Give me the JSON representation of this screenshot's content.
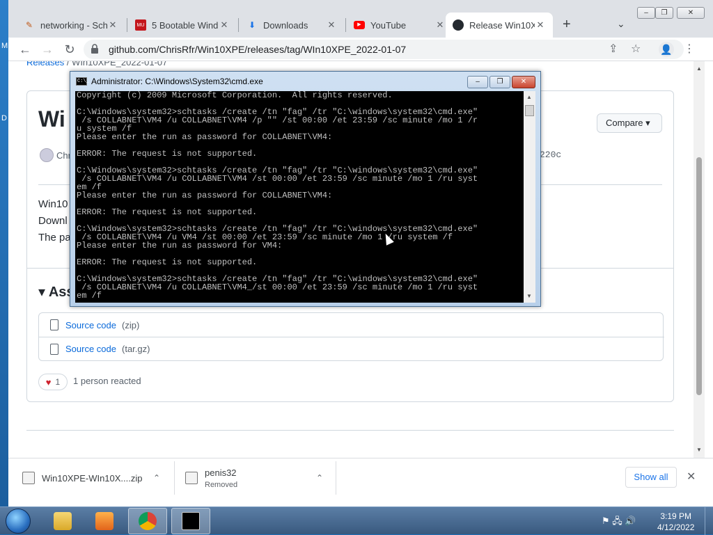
{
  "window_controls": {
    "minimize": "–",
    "maximize": "❐",
    "close": "✕"
  },
  "tabs": [
    {
      "label": "networking - Sch",
      "close": "✕"
    },
    {
      "label": "5 Bootable Wind",
      "close": "✕"
    },
    {
      "label": "Downloads",
      "close": "✕"
    },
    {
      "label": "YouTube",
      "close": "✕"
    },
    {
      "label": "Release Win10XP",
      "close": "✕"
    }
  ],
  "new_tab": "+",
  "tab_search": "⌄",
  "toolbar": {
    "back": "←",
    "forward": "→",
    "reload": "↻",
    "url": "github.com/ChrisRfr/Win10XPE/releases/tag/WIn10XPE_2022-01-07",
    "share": "⇪",
    "star": "☆",
    "menu": "⋮",
    "avatar": "👤"
  },
  "page": {
    "crumb_link": "Releases",
    "crumb_sep": " / ",
    "crumb_current": "WIn10XPE_2022-01-07",
    "release_title": "Wi",
    "author": "Chr",
    "commit": "220c",
    "compare_label": "Compare ▾",
    "body_lines": [
      "Win10",
      "Downl",
      "The pa"
    ],
    "assets_label": "▾ Ass",
    "assets": [
      {
        "name": "Source code",
        "type": "(zip)"
      },
      {
        "name": "Source code",
        "type": "(tar.gz)"
      }
    ],
    "reaction_heart": "♥",
    "reaction_count": "1",
    "reacted_text": "1 person reacted"
  },
  "cmd": {
    "title": "Administrator: C:\\Windows\\System32\\cmd.exe",
    "icon_text": "C:\\_",
    "minimize": "–",
    "maximize": "❐",
    "close": "✕",
    "lines": [
      "Copyright (c) 2009 Microsoft Corporation.  All rights reserved.",
      "",
      "C:\\Windows\\system32>schtasks /create /tn \"fag\" /tr \"C:\\windows\\system32\\cmd.exe\"",
      " /s COLLABNET\\VM4 /u COLLABNET\\VM4 /p \"\" /st 00:00 /et 23:59 /sc minute /mo 1 /r",
      "u system /f",
      "Please enter the run as password for COLLABNET\\VM4:",
      "",
      "ERROR: The request is not supported.",
      "",
      "C:\\Windows\\system32>schtasks /create /tn \"fag\" /tr \"C:\\windows\\system32\\cmd.exe\"",
      " /s COLLABNET\\VM4 /u COLLABNET\\VM4 /st 00:00 /et 23:59 /sc minute /mo 1 /ru syst",
      "em /f",
      "Please enter the run as password for COLLABNET\\VM4:",
      "",
      "ERROR: The request is not supported.",
      "",
      "C:\\Windows\\system32>schtasks /create /tn \"fag\" /tr \"C:\\windows\\system32\\cmd.exe\"",
      " /s COLLABNET\\VM4 /u VM4 /st 00:00 /et 23:59 /sc minute /mo 1 /ru system /f",
      "Please enter the run as password for VM4:",
      "",
      "ERROR: The request is not supported.",
      "",
      "C:\\Windows\\system32>schtasks /create /tn \"fag\" /tr \"C:\\windows\\system32\\cmd.exe\"",
      " /s COLLABNET\\VM4 /u COLLABNET\\VM4_/st 00:00 /et 23:59 /sc minute /mo 1 /ru syst",
      "em /f"
    ]
  },
  "downloads": [
    {
      "name": "Win10XPE-WIn10X....zip",
      "chevron": "⌃"
    },
    {
      "name": "penis32",
      "status": "Removed",
      "chevron": "⌃"
    }
  ],
  "show_all": "Show all",
  "shelf_close": "✕",
  "desktop_edge": [
    "M",
    "D"
  ],
  "taskbar": {
    "time": "3:19 PM",
    "date": "4/12/2022",
    "tray_icons": "⚑ 🖧 🔊"
  }
}
